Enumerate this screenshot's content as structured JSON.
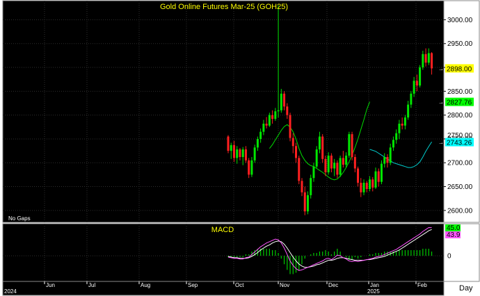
{
  "chart_data": {
    "type": "candlestick",
    "title": "Gold Online Futures Mar-25 (GOH25)",
    "note": "No Gaps",
    "period_label": "Day",
    "colors": {
      "background": "#000000",
      "up": "#00e600",
      "down": "#ff2020",
      "ma_fast": "#00dd00",
      "ma_slow": "#00cccc",
      "title": "#ffff00",
      "macd_line": "#ff55ff",
      "macd_signal": "#ffffff",
      "histogram": "#00cc00"
    },
    "price_axis": {
      "range": [
        2575,
        3040
      ],
      "ticks": [
        "2600.00",
        "2650.00",
        "2700.00",
        "2750.00",
        "2800.00",
        "2850.00",
        "2900.00",
        "2950.00",
        "3000.00"
      ],
      "tick_values": [
        2600,
        2650,
        2700,
        2750,
        2800,
        2850,
        2900,
        2950,
        3000
      ]
    },
    "last_values": [
      {
        "label": "2898.00",
        "value": 2898.0,
        "color": "#ffff00"
      },
      {
        "label": "2827.76",
        "value": 2827.76,
        "color": "#00ff00"
      },
      {
        "label": "2743.26",
        "value": 2743.26,
        "color": "#00ffff"
      }
    ],
    "hidden_label": "2750.00",
    "macd": {
      "title": "MACD",
      "range": [
        -40,
        50
      ],
      "ticks": [
        {
          "label": "0",
          "value": 0
        }
      ],
      "last_values": [
        {
          "label": "45.0",
          "value": 45.0,
          "color": "#00ff00"
        },
        {
          "label": "43.9",
          "value": 43.9,
          "color": "#ff55ff"
        }
      ]
    },
    "months": [
      "Jun",
      "Jul",
      "Aug",
      "Sep",
      "Oct",
      "Nov",
      "Dec",
      "Jan",
      "Feb"
    ],
    "years": [
      "2024",
      "2025"
    ],
    "candles": [
      [
        2755,
        2758,
        2720,
        2725
      ],
      [
        2725,
        2742,
        2708,
        2737
      ],
      [
        2737,
        2746,
        2702,
        2710
      ],
      [
        2710,
        2735,
        2698,
        2728
      ],
      [
        2728,
        2731,
        2705,
        2712
      ],
      [
        2712,
        2733,
        2695,
        2728
      ],
      [
        2728,
        2735,
        2700,
        2705
      ],
      [
        2705,
        2710,
        2668,
        2675
      ],
      [
        2675,
        2712,
        2670,
        2705
      ],
      [
        2705,
        2738,
        2700,
        2732
      ],
      [
        2732,
        2755,
        2725,
        2750
      ],
      [
        2750,
        2772,
        2742,
        2765
      ],
      [
        2765,
        2790,
        2758,
        2782
      ],
      [
        2782,
        2796,
        2772,
        2778
      ],
      [
        2778,
        2805,
        2775,
        2800
      ],
      [
        2800,
        2810,
        2782,
        2792
      ],
      [
        2792,
        2815,
        2788,
        2808
      ],
      [
        2808,
        3030,
        2795,
        2810
      ],
      [
        2810,
        2855,
        2805,
        2845
      ],
      [
        2845,
        2850,
        2810,
        2818
      ],
      [
        2818,
        2825,
        2792,
        2800
      ],
      [
        2800,
        2805,
        2745,
        2752
      ],
      [
        2752,
        2762,
        2720,
        2735
      ],
      [
        2735,
        2742,
        2700,
        2710
      ],
      [
        2710,
        2715,
        2655,
        2662
      ],
      [
        2662,
        2668,
        2630,
        2638
      ],
      [
        2638,
        2650,
        2590,
        2598
      ],
      [
        2598,
        2640,
        2592,
        2632
      ],
      [
        2632,
        2675,
        2625,
        2668
      ],
      [
        2668,
        2700,
        2660,
        2692
      ],
      [
        2692,
        2735,
        2688,
        2728
      ],
      [
        2728,
        2765,
        2720,
        2755
      ],
      [
        2755,
        2760,
        2700,
        2708
      ],
      [
        2708,
        2715,
        2672,
        2680
      ],
      [
        2680,
        2722,
        2675,
        2715
      ],
      [
        2715,
        2720,
        2680,
        2688
      ],
      [
        2688,
        2708,
        2672,
        2700
      ],
      [
        2700,
        2705,
        2668,
        2675
      ],
      [
        2675,
        2715,
        2670,
        2710
      ],
      [
        2710,
        2725,
        2690,
        2696
      ],
      [
        2696,
        2722,
        2690,
        2715
      ],
      [
        2715,
        2765,
        2710,
        2760
      ],
      [
        2760,
        2765,
        2705,
        2712
      ],
      [
        2712,
        2718,
        2680,
        2688
      ],
      [
        2688,
        2692,
        2650,
        2658
      ],
      [
        2658,
        2668,
        2628,
        2638
      ],
      [
        2638,
        2665,
        2632,
        2658
      ],
      [
        2658,
        2662,
        2638,
        2645
      ],
      [
        2645,
        2672,
        2640,
        2665
      ],
      [
        2665,
        2670,
        2640,
        2648
      ],
      [
        2648,
        2690,
        2645,
        2682
      ],
      [
        2682,
        2688,
        2650,
        2660
      ],
      [
        2660,
        2705,
        2655,
        2698
      ],
      [
        2698,
        2720,
        2690,
        2712
      ],
      [
        2712,
        2718,
        2690,
        2700
      ],
      [
        2700,
        2740,
        2695,
        2732
      ],
      [
        2732,
        2755,
        2725,
        2748
      ],
      [
        2748,
        2770,
        2740,
        2762
      ],
      [
        2762,
        2790,
        2750,
        2782
      ],
      [
        2782,
        2795,
        2770,
        2778
      ],
      [
        2778,
        2800,
        2770,
        2795
      ],
      [
        2795,
        2830,
        2790,
        2822
      ],
      [
        2822,
        2850,
        2815,
        2845
      ],
      [
        2845,
        2880,
        2838,
        2872
      ],
      [
        2872,
        2885,
        2850,
        2862
      ],
      [
        2862,
        2905,
        2858,
        2900
      ],
      [
        2900,
        2935,
        2895,
        2928
      ],
      [
        2928,
        2940,
        2902,
        2910
      ],
      [
        2910,
        2940,
        2905,
        2930
      ],
      [
        2930,
        2932,
        2885,
        2898
      ]
    ],
    "ma_fast_values": [
      2730,
      2738,
      2748,
      2758,
      2768,
      2776,
      2780,
      2775,
      2765,
      2750,
      2730,
      2715,
      2705,
      2698,
      2694,
      2692,
      2688,
      2684,
      2680,
      2675,
      2670,
      2666,
      2664,
      2666,
      2672,
      2680,
      2690,
      2702,
      2716,
      2732,
      2750,
      2770,
      2790,
      2812,
      2828
    ],
    "ma_fast_start": 14,
    "ma_slow_values": [
      2728,
      2726,
      2724,
      2720,
      2716,
      2712,
      2708,
      2704,
      2700,
      2698,
      2696,
      2694,
      2692,
      2690,
      2690,
      2692,
      2696,
      2702,
      2712,
      2724,
      2734,
      2744
    ],
    "ma_slow_start": 48,
    "macd_line_values": [
      -2,
      -3,
      -4,
      -4,
      -5,
      -5,
      -3,
      -2,
      2,
      6,
      10,
      14,
      17,
      20,
      22,
      24,
      26,
      25,
      20,
      12,
      2,
      -8,
      -15,
      -20,
      -23,
      -22,
      -20,
      -18,
      -16,
      -14,
      -12,
      -10,
      -8,
      -5,
      -4,
      -6,
      -3,
      1,
      0,
      -3,
      -5,
      -8,
      -9,
      -8,
      -9,
      -8,
      -7,
      -6,
      -5,
      -4,
      -2,
      -1,
      0,
      2,
      4,
      6,
      8,
      10,
      13,
      16,
      19,
      22,
      25,
      28,
      31,
      34,
      38,
      41,
      44,
      43.9
    ],
    "macd_signal_values": [
      -1,
      -2,
      -3,
      -3,
      -4,
      -4,
      -4,
      -3,
      -1,
      2,
      5,
      9,
      12,
      15,
      17,
      20,
      22,
      23,
      22,
      18,
      12,
      5,
      -2,
      -8,
      -13,
      -16,
      -18,
      -18,
      -17,
      -16,
      -14,
      -13,
      -11,
      -9,
      -7,
      -7,
      -6,
      -4,
      -3,
      -3,
      -4,
      -5,
      -6,
      -7,
      -7,
      -7,
      -7,
      -6,
      -6,
      -5,
      -4,
      -3,
      -2,
      -1,
      1,
      3,
      5,
      7,
      9,
      12,
      15,
      18,
      21,
      24,
      27,
      30,
      33,
      36,
      39,
      41
    ],
    "macd_hist_values": [
      -1,
      -1,
      -1,
      -1,
      -1,
      -1,
      1,
      1,
      3,
      4,
      5,
      5,
      5,
      5,
      5,
      4,
      4,
      2,
      -2,
      -6,
      -10,
      -13,
      -13,
      -12,
      -10,
      -6,
      -2,
      0,
      1,
      2,
      2,
      3,
      3,
      4,
      3,
      1,
      3,
      5,
      3,
      0,
      -1,
      -3,
      -3,
      -1,
      -2,
      -1,
      0,
      0,
      1,
      1,
      2,
      2,
      2,
      3,
      3,
      3,
      3,
      3,
      4,
      4,
      4,
      4,
      4,
      4,
      4,
      4,
      5,
      5,
      5,
      3
    ]
  }
}
